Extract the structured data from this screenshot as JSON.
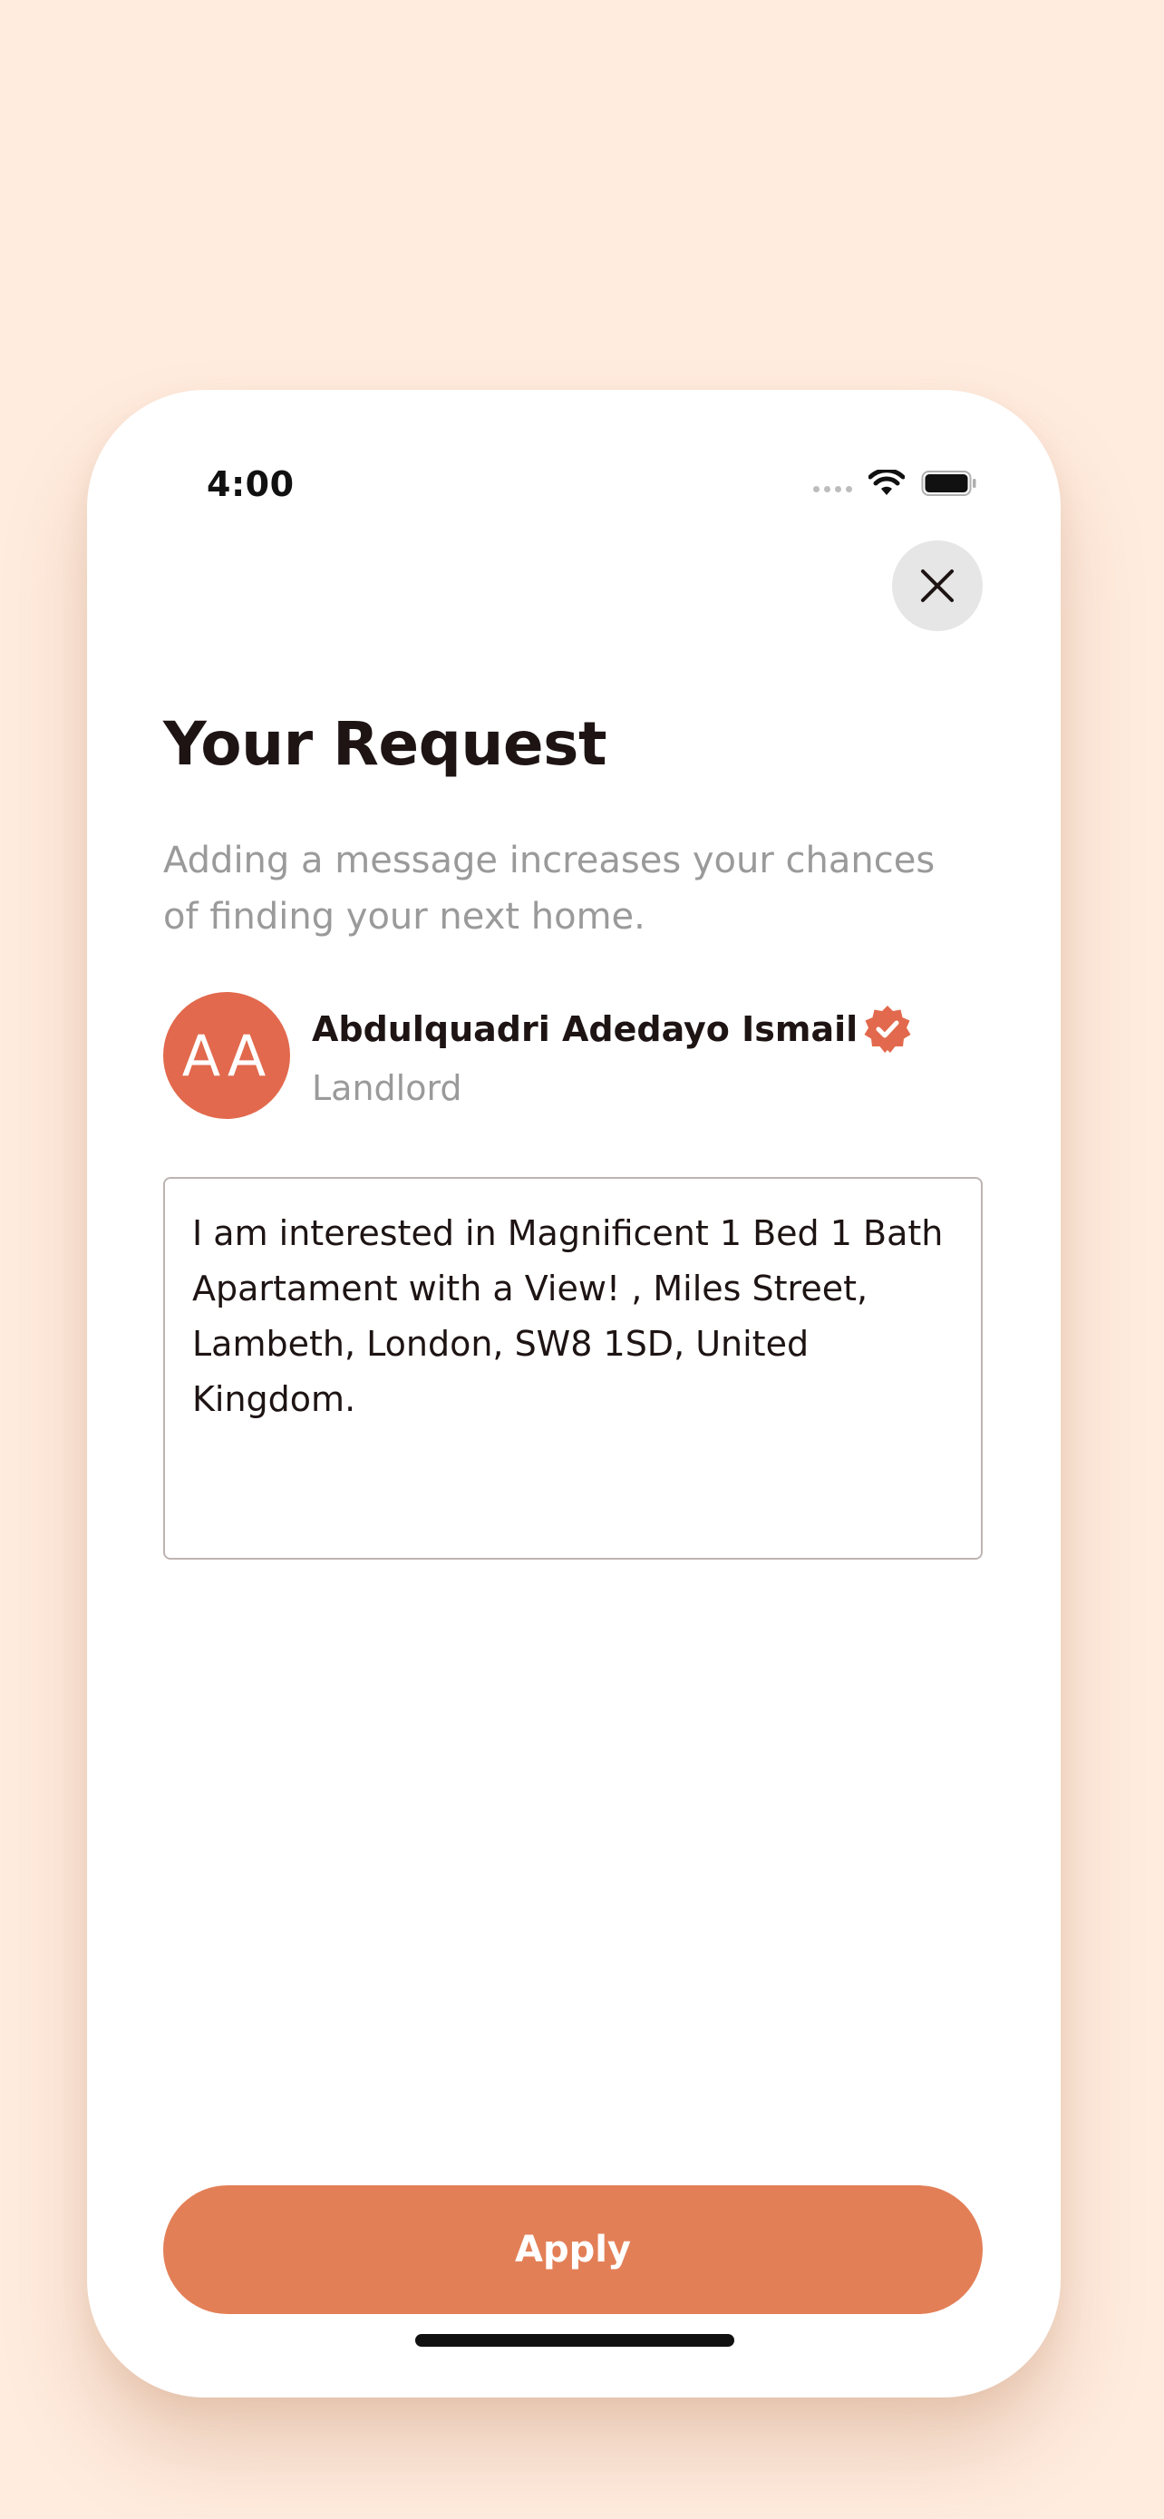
{
  "status_bar": {
    "time": "4:00"
  },
  "header": {
    "close_icon": "close-icon",
    "title": "Your Request",
    "subtitle": "Adding a message increases your chances of finding your next home."
  },
  "landlord": {
    "initials": "AA",
    "name": "Abdulquadri Adedayo Ismail",
    "role": "Landlord",
    "verified_icon": "verified-badge-icon"
  },
  "message": {
    "value": "I am interested in Magnificent 1 Bed 1 Bath Apartament with a View!  , Miles Street, Lambeth, London, SW8 1SD, United Kingdom."
  },
  "footer": {
    "apply_label": "Apply"
  },
  "colors": {
    "background": "#FFECDF",
    "accent": "#E37F57",
    "avatar": "#E2694D",
    "title_text": "#1E1414",
    "muted_text": "#9A9A9A"
  }
}
